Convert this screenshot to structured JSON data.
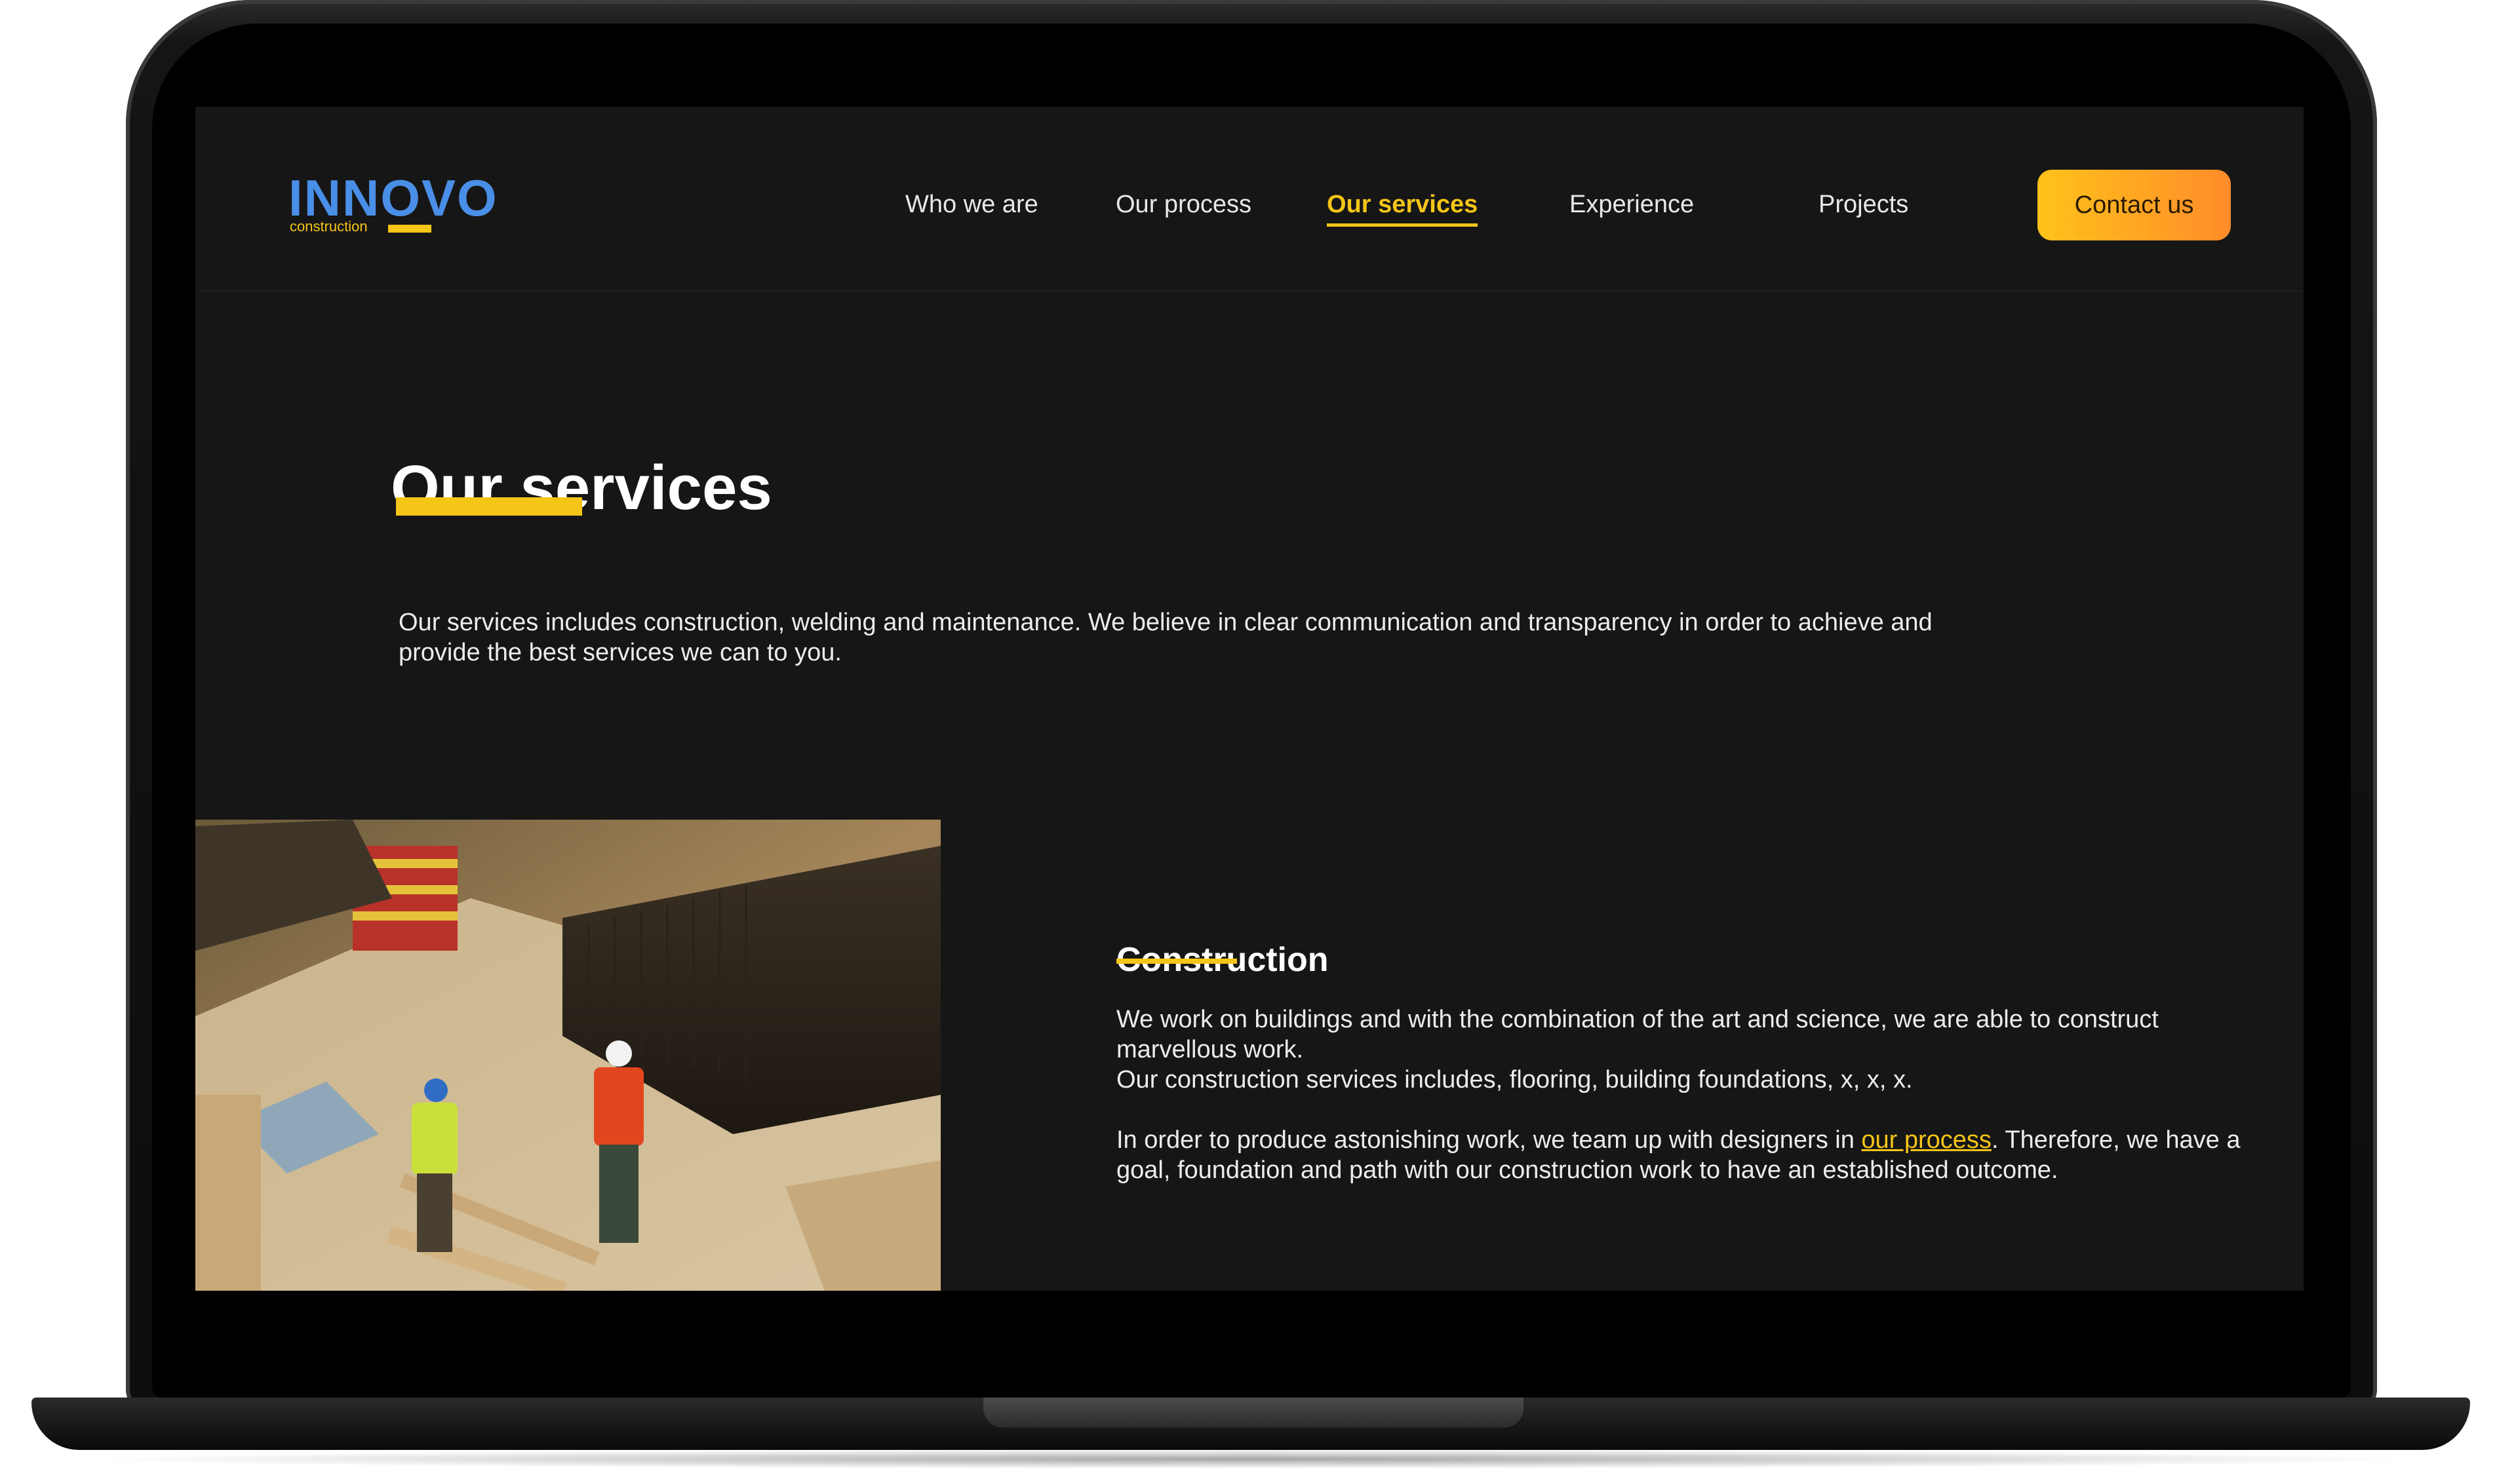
{
  "brand": {
    "name": "INNOVO",
    "tagline": "construction"
  },
  "nav": {
    "items": [
      {
        "label": "Who we are"
      },
      {
        "label": "Our process"
      },
      {
        "label": "Our services"
      },
      {
        "label": "Experience"
      },
      {
        "label": "Projects"
      }
    ],
    "active": "Our services",
    "contact_label": "Contact us"
  },
  "hero": {
    "title": "Our services",
    "intro": "Our services includes construction, welding and maintenance. We believe in clear communication and transparency in order to achieve and provide the best services we can to you."
  },
  "construction": {
    "heading": "Construction",
    "paragraph1_line1": "We work on buildings and with the combination of the art and science, we are able to construct marvellous work.",
    "paragraph1_line2": "Our construction services includes, flooring, building foundations, x, x, x.",
    "paragraph2_before": "In order to produce astonishing work, we team up with designers in ",
    "paragraph2_link": "our process",
    "paragraph2_after": ". Therefore, we have a goal, foundation and path with our construction work to have an established outcome."
  },
  "colors": {
    "accent": "#f5c518",
    "logo_blue": "#4a8fe7",
    "background": "#161616",
    "button_gradient_start": "#ffc21a",
    "button_gradient_end": "#ff8c2a"
  }
}
